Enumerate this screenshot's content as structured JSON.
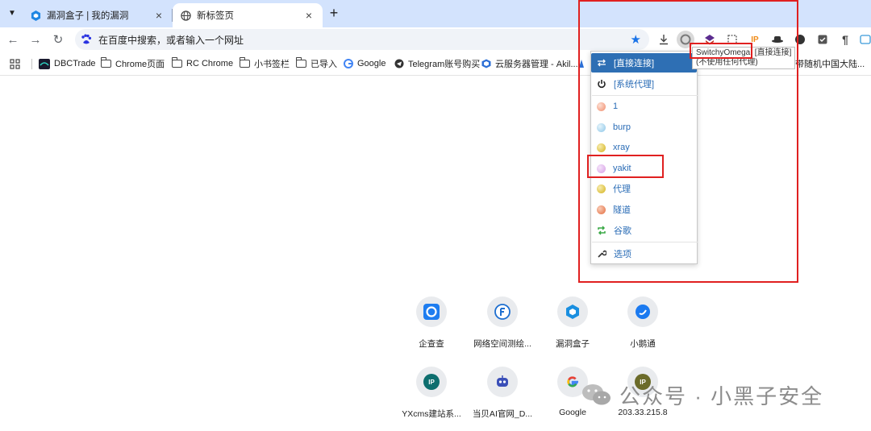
{
  "tabs": [
    {
      "title": "漏洞盒子 | 我的漏洞",
      "active": false
    },
    {
      "title": "新标签页",
      "active": true
    }
  ],
  "omnibox": {
    "placeholder": "在百度中搜索，或者输入一个网址"
  },
  "bookmarks": [
    {
      "label": "DBCTrade"
    },
    {
      "label": "Chrome页面"
    },
    {
      "label": "RC Chrome"
    },
    {
      "label": "小书签栏"
    },
    {
      "label": "已导入"
    },
    {
      "label": "Google"
    },
    {
      "label": "Telegram账号购买"
    },
    {
      "label": "云服务器管理 - Akil..."
    }
  ],
  "bookmark_overflow": "带随机中国大陆...",
  "extension_badge": "IP",
  "tooltip": {
    "line1": "SwitchyOmega: [直接连接]",
    "line2": "(不使用任何代理)"
  },
  "popup": {
    "items": [
      {
        "label": "[直接连接]",
        "icon": "transfer-icon",
        "active": true
      },
      {
        "label": "[系统代理]",
        "icon": "power-icon"
      },
      {
        "label": "1",
        "icon": "globe-icon",
        "color": "#f08a6a"
      },
      {
        "label": "burp",
        "icon": "globe-icon",
        "color": "#8cc6e8"
      },
      {
        "label": "xray",
        "icon": "globe-icon",
        "color": "#d4b21a"
      },
      {
        "label": "yakit",
        "icon": "globe-icon",
        "color": "#d79ee6"
      },
      {
        "label": "代理",
        "icon": "globe-icon",
        "color": "#d4b21a"
      },
      {
        "label": "隧道",
        "icon": "globe-icon",
        "color": "#e36a3c"
      },
      {
        "label": "谷歌",
        "icon": "switch-icon",
        "color": "#39a845"
      },
      {
        "label": "选项",
        "icon": "wrench-icon"
      }
    ]
  },
  "shortcuts": [
    {
      "label": "企查查",
      "color": "#1e7df0"
    },
    {
      "label": "网络空间测绘...",
      "color": "#1e6fd0"
    },
    {
      "label": "漏洞盒子",
      "color": "#1a8fe0"
    },
    {
      "label": "小鹅通",
      "color": "#1b7af0"
    },
    {
      "label": "YXcms建站系...",
      "color": "#0d6e6e",
      "icon_text": "IP"
    },
    {
      "label": "当贝AI官网_D...",
      "color": "#3a4fb8"
    },
    {
      "label": "Google",
      "color": "#4285f4"
    },
    {
      "label": "203.33.215.8",
      "color": "#6b6b2a",
      "icon_text": "IP"
    }
  ],
  "watermark": "公众号 · 小黑子安全",
  "colors": {
    "accent": "#2e6fb4",
    "highlight": "#e02020",
    "tabstrip": "#d3e3fd"
  }
}
